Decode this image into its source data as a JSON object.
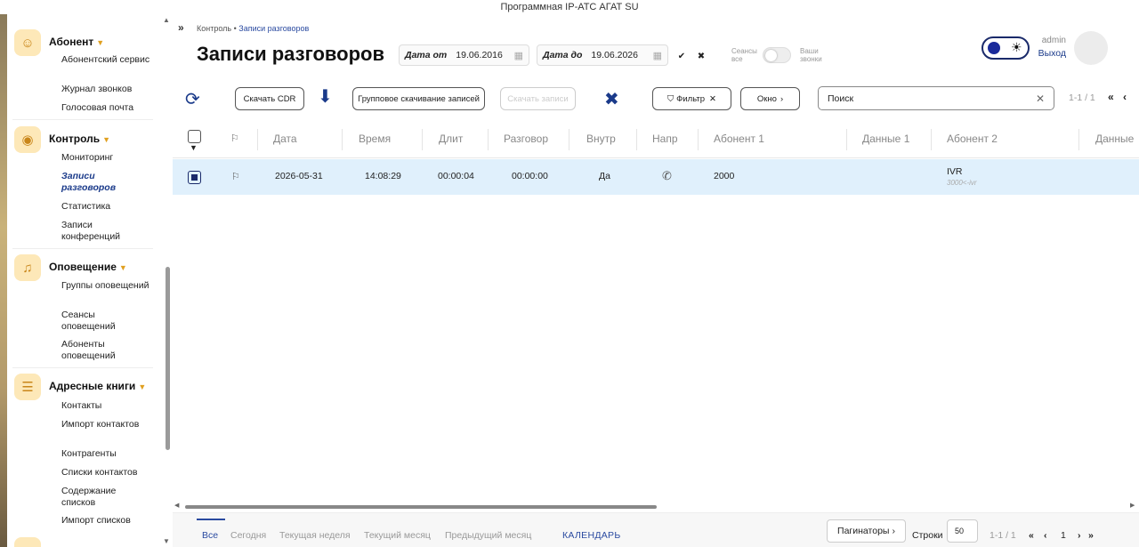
{
  "window": {
    "title": "Программная IP-АТС АГАТ SU"
  },
  "sidebar": {
    "sections": [
      {
        "title": "Абонент",
        "icon": "user-icon",
        "items": [
          "Абонентский сервис",
          "Журнал звонков",
          "Голосовая почта"
        ]
      },
      {
        "title": "Контроль",
        "icon": "control-icon",
        "items": [
          "Мониторинг",
          "Записи разговоров",
          "Статистика",
          "Записи конференций"
        ],
        "active": "Записи разговоров"
      },
      {
        "title": "Оповещение",
        "icon": "bell-icon",
        "items": [
          "Группы оповещений",
          "Сеансы оповещений",
          "Абоненты оповещений"
        ]
      },
      {
        "title": "Адресные книги",
        "icon": "address-book-icon",
        "items": [
          "Контакты",
          "Импорт контактов",
          "Контрагенты",
          "Списки контактов",
          "Содержание списков",
          "Импорт списков"
        ]
      }
    ]
  },
  "header": {
    "breadcrumb_root": "Контроль",
    "breadcrumb_sep": "•",
    "breadcrumb_current": "Записи разговоров",
    "title": "Записи разговоров",
    "date_from_label": "Дата от",
    "date_from": "19.06.2016",
    "date_to_label": "Дата до",
    "date_to": "19.06.2026",
    "toggle_left": "Сеансы все",
    "toggle_right": "Ваши звонки",
    "user": "admin",
    "logout": "Выход"
  },
  "toolbar": {
    "download_cdr": "Скачать CDR",
    "group_download": "Групповое скачивание записей",
    "download_records": "Скачать записи",
    "filter": "Фильтр",
    "window": "Окно",
    "search_placeholder": "Поиск",
    "pagination": "1-1 / 1"
  },
  "table": {
    "columns": [
      "Дата",
      "Время",
      "Длит",
      "Разговор",
      "Внутр",
      "Напр",
      "Абонент 1",
      "Данные 1",
      "Абонент 2",
      "Данные"
    ],
    "rows": [
      {
        "date": "2026-05-31",
        "time": "14:08:29",
        "duration": "00:00:04",
        "talk": "00:00:00",
        "internal": "Да",
        "direction": "phone-incoming-icon",
        "abonent1": "2000",
        "data1": "",
        "abonent2": "IVR",
        "abonent2_sub": "3000<-ivr"
      }
    ]
  },
  "footer": {
    "tabs": [
      "Все",
      "Сегодня",
      "Текущая неделя",
      "Текущий месяц",
      "Предыдущий месяц"
    ],
    "active_tab": "Все",
    "calendar": "КАЛЕНДАРЬ",
    "paginators": "Пагинаторы",
    "rows_label": "Строки",
    "rows_value": "50",
    "pagination": "1-1 / 1",
    "page": "1"
  }
}
